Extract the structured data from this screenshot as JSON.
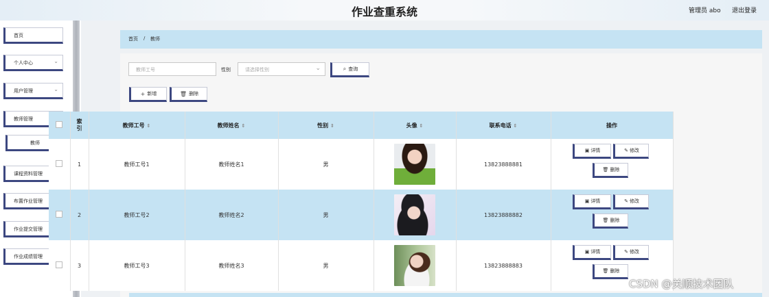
{
  "header": {
    "title": "作业查重系统",
    "admin": "管理员 abo",
    "logout": "退出登录"
  },
  "sidebar": {
    "items": [
      {
        "label": "首页",
        "chevron": ""
      },
      {
        "label": "个人中心",
        "chevron": "⌄"
      },
      {
        "label": "用户管理",
        "chevron": "⌄"
      },
      {
        "label": "教师管理",
        "chevron": "⌄"
      },
      {
        "label": "教师",
        "chevron": ""
      },
      {
        "label": "课程资料管理",
        "chevron": "⌄"
      },
      {
        "label": "布置作业管理",
        "chevron": "⌄"
      },
      {
        "label": "作业提交管理",
        "chevron": "⌄"
      },
      {
        "label": "作业成绩管理",
        "chevron": "⌄"
      }
    ]
  },
  "breadcrumb": {
    "home": "首页",
    "sep": "/",
    "current": "教师"
  },
  "search": {
    "teacher_no_placeholder": "教师工号",
    "gender_label": "性别",
    "gender_placeholder": "请选择性别",
    "query_label": "查询"
  },
  "actions": {
    "add_label": "新增",
    "delete_label": "删除"
  },
  "table": {
    "headers": {
      "index": "索引",
      "teacher_no": "教师工号",
      "teacher_name": "教师姓名",
      "gender": "性别",
      "avatar": "头像",
      "phone": "联系电话",
      "ops": "操作"
    },
    "rows": [
      {
        "index": "1",
        "teacher_no": "教师工号1",
        "teacher_name": "教师姓名1",
        "gender": "男",
        "phone": "13823888881"
      },
      {
        "index": "2",
        "teacher_no": "教师工号2",
        "teacher_name": "教师姓名2",
        "gender": "男",
        "phone": "13823888882"
      },
      {
        "index": "3",
        "teacher_no": "教师工号3",
        "teacher_name": "教师姓名3",
        "gender": "男",
        "phone": "13823888883"
      }
    ],
    "row_ops": {
      "detail": "详情",
      "edit": "修改",
      "delete": "删除"
    }
  },
  "watermark": "CSDN @关顺技术团队",
  "colors": {
    "accent": "#3c4780",
    "header_blue": "#c5e3f3"
  }
}
